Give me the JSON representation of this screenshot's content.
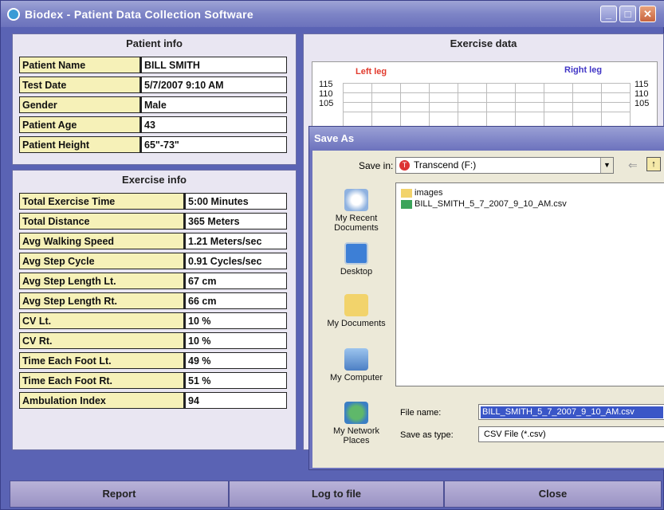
{
  "window": {
    "title": "Biodex - Patient Data Collection Software",
    "min": "_",
    "max": "□",
    "close": "✕"
  },
  "patient": {
    "header": "Patient info",
    "rows": [
      {
        "label": "Patient Name",
        "value": "BILL SMITH"
      },
      {
        "label": "Test Date",
        "value": "5/7/2007 9:10 AM"
      },
      {
        "label": "Gender",
        "value": "Male"
      },
      {
        "label": "Patient Age",
        "value": "43"
      },
      {
        "label": "Patient Height",
        "value": "65\"-73\""
      }
    ]
  },
  "exercise_info": {
    "header": "Exercise info",
    "rows": [
      {
        "label": "Total Exercise Time",
        "value": "5:00 Minutes"
      },
      {
        "label": "Total Distance",
        "value": "365 Meters"
      },
      {
        "label": "Avg Walking Speed",
        "value": "1.21 Meters/sec"
      },
      {
        "label": "Avg Step Cycle",
        "value": "0.91 Cycles/sec"
      },
      {
        "label": "Avg Step Length Lt.",
        "value": "67 cm"
      },
      {
        "label": "Avg Step Length Rt.",
        "value": "66 cm"
      },
      {
        "label": "CV Lt.",
        "value": "10 %"
      },
      {
        "label": "CV Rt.",
        "value": "10 %"
      },
      {
        "label": "Time Each Foot Lt.",
        "value": "49 %"
      },
      {
        "label": "Time Each Foot Rt.",
        "value": "51 %"
      },
      {
        "label": "Ambulation Index",
        "value": "94"
      }
    ]
  },
  "exercise_data": {
    "header": "Exercise data",
    "left_label": "Left leg",
    "right_label": "Right leg",
    "ticks": [
      "115",
      "110",
      "105"
    ],
    "left_color": "#e23b2e",
    "right_color": "#4136c6"
  },
  "buttons": {
    "report": "Report",
    "log": "Log to file",
    "close": "Close"
  },
  "dialog": {
    "title": "Save As",
    "save_in_label": "Save in:",
    "save_in_value": "Transcend (F:)",
    "places": [
      "My Recent Documents",
      "Desktop",
      "My Documents",
      "My Computer",
      "My Network Places"
    ],
    "files": [
      "images",
      "BILL_SMITH_5_7_2007_9_10_AM.csv"
    ],
    "file_name_label": "File name:",
    "file_name_value": "BILL_SMITH_5_7_2007_9_10_AM.csv",
    "save_type_label": "Save as type:",
    "save_type_value": "CSV File (*.csv)"
  }
}
